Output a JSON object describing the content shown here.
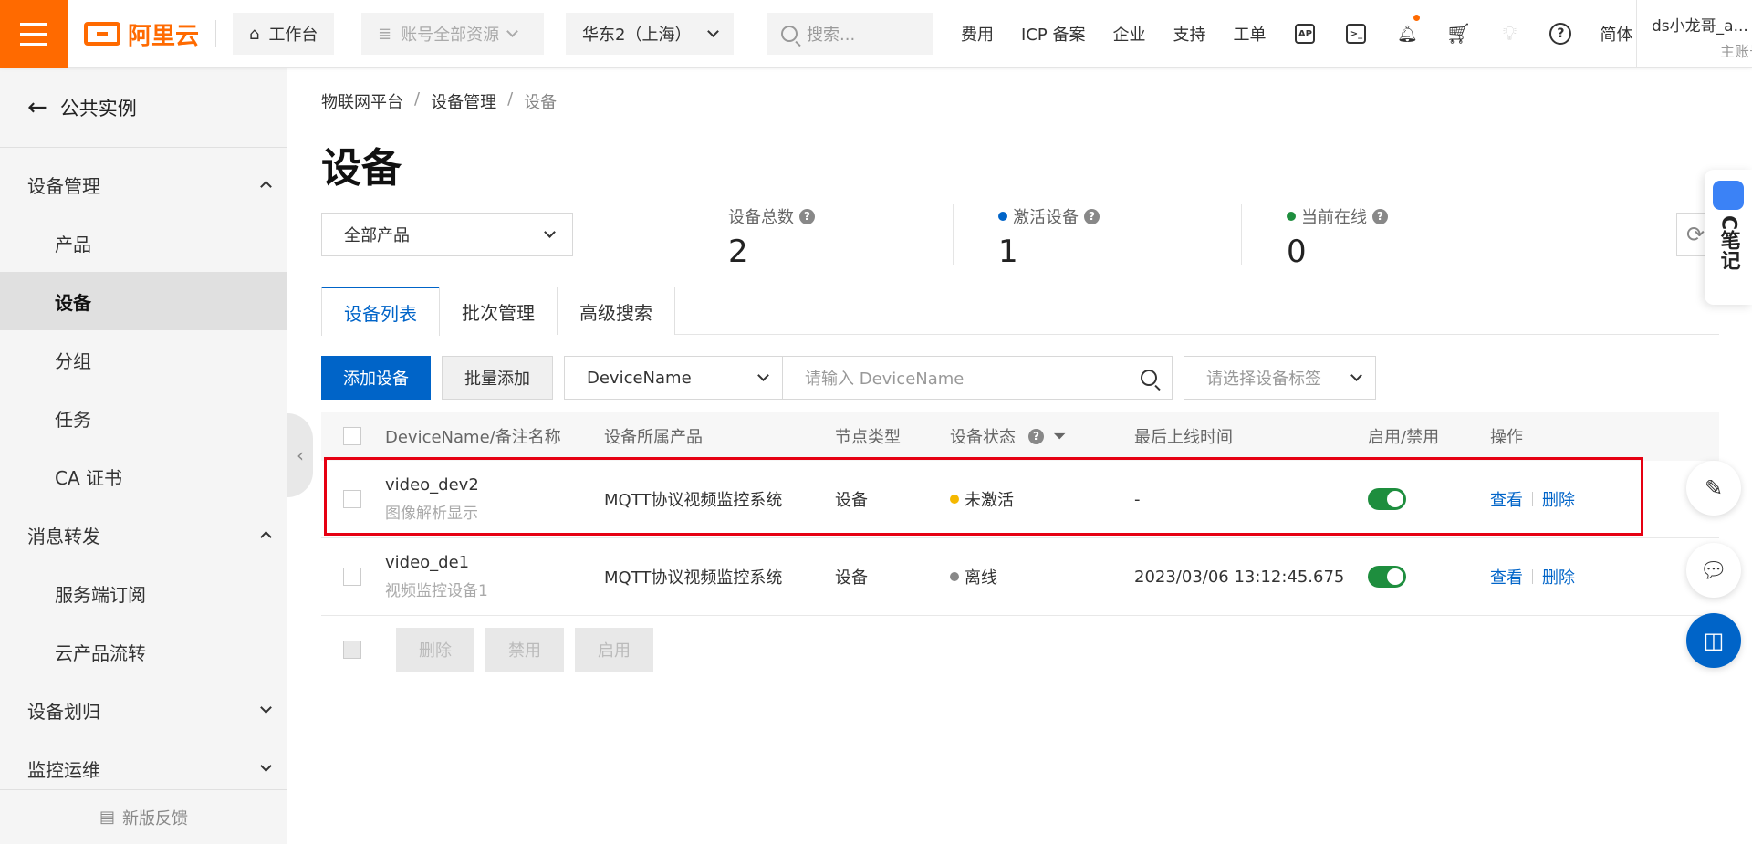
{
  "topbar": {
    "logo": "阿里云",
    "workbench": "工作台",
    "resources": "账号全部资源",
    "region": "华东2（上海）",
    "search_placeholder": "搜索...",
    "nav": [
      "费用",
      "ICP 备案",
      "企业",
      "支持",
      "工单"
    ],
    "lang": "简体",
    "user_name": "ds小龙哥_a...",
    "user_role": "主账号"
  },
  "sidebar": {
    "back": "公共实例",
    "groups": [
      {
        "label": "设备管理",
        "items": [
          "产品",
          "设备",
          "分组",
          "任务",
          "CA 证书"
        ]
      },
      {
        "label": "消息转发",
        "items": [
          "服务端订阅",
          "云产品流转"
        ]
      },
      {
        "label": "设备划归",
        "items": []
      },
      {
        "label": "监控运维",
        "items": []
      }
    ],
    "feedback": "新版反馈"
  },
  "breadcrumb": [
    "物联网平台",
    "设备管理",
    "设备"
  ],
  "page_title": "设备",
  "product_select": "全部产品",
  "stats": {
    "total_label": "设备总数",
    "total": "2",
    "active_label": "激活设备",
    "active": "1",
    "online_label": "当前在线",
    "online": "0"
  },
  "tabs": [
    "设备列表",
    "批次管理",
    "高级搜索"
  ],
  "toolbar": {
    "add": "添加设备",
    "batch_add": "批量添加",
    "field": "DeviceName",
    "input_placeholder": "请输入 DeviceName",
    "tag_placeholder": "请选择设备标签"
  },
  "table": {
    "headers": [
      "DeviceName/备注名称",
      "设备所属产品",
      "节点类型",
      "设备状态",
      "最后上线时间",
      "启用/禁用",
      "操作"
    ],
    "rows": [
      {
        "name": "video_dev2",
        "note": "图像解析显示",
        "product": "MQTT协议视频监控系统",
        "node": "设备",
        "status": "未激活",
        "status_color": "#f5b800",
        "time": "-",
        "view": "查看",
        "delete": "删除"
      },
      {
        "name": "video_de1",
        "note": "视频监控设备1",
        "product": "MQTT协议视频监控系统",
        "node": "设备",
        "status": "离线",
        "status_color": "#888888",
        "time": "2023/03/06 13:12:45.675",
        "view": "查看",
        "delete": "删除"
      }
    ]
  },
  "bulk": [
    "删除",
    "禁用",
    "启用"
  ],
  "float_note": "C笔记",
  "colors": {
    "brand": "#ff6a00",
    "primary": "#0064c8",
    "toggle_on": "#1e8e3e",
    "highlight": "#e60012"
  }
}
